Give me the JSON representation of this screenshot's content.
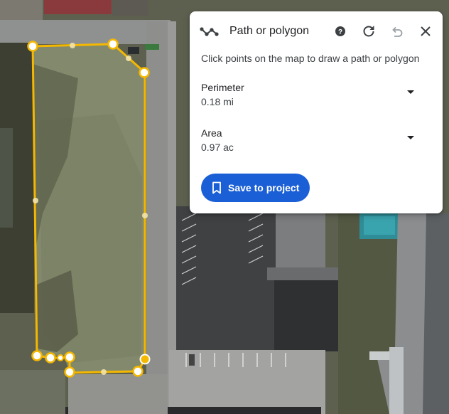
{
  "panel": {
    "title": "Path or polygon",
    "hint": "Click points on the map to draw a path or polygon",
    "tool_icon": "path-tool-icon",
    "actions": {
      "help_icon": "help-icon",
      "redo_icon": "refresh-icon",
      "undo_icon": "undo-icon",
      "close_icon": "close-icon"
    },
    "metrics": [
      {
        "label": "Perimeter",
        "value": "0.18 mi"
      },
      {
        "label": "Area",
        "value": "0.97 ac"
      }
    ],
    "save_label": "Save to project"
  },
  "colors": {
    "accent": "#1b5fd6",
    "path": "#f5b800",
    "vertex_fill": "#ffffff",
    "active_vertex": "#f5b800"
  }
}
